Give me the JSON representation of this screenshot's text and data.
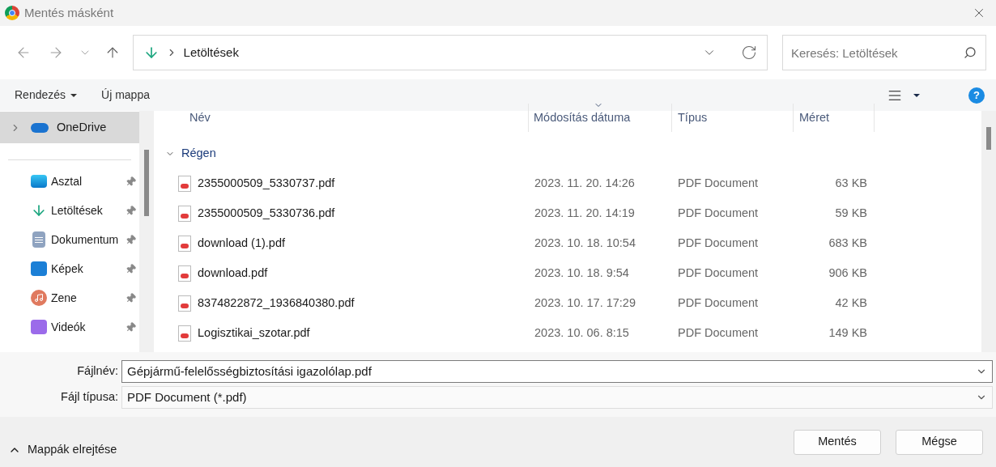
{
  "window": {
    "title": "Mentés másként"
  },
  "nav": {
    "path": "Letöltések",
    "search": {
      "placeholder": "Keresés: Letöltések"
    }
  },
  "toolbar": {
    "organize": "Rendezés",
    "new_folder": "Új mappa",
    "help": "?"
  },
  "sidebar": {
    "top": {
      "label": "OneDrive",
      "selected": true
    },
    "items": [
      {
        "label": "Asztal",
        "kind": "desktop",
        "pinned": true
      },
      {
        "label": "Letöltések",
        "kind": "download",
        "pinned": true
      },
      {
        "label": "Dokumentum",
        "kind": "document",
        "pinned": true
      },
      {
        "label": "Képek",
        "kind": "pictures",
        "pinned": true
      },
      {
        "label": "Zene",
        "kind": "music",
        "pinned": true
      },
      {
        "label": "Videók",
        "kind": "video",
        "pinned": true
      }
    ]
  },
  "table": {
    "columns": [
      "Név",
      "Módosítás dátuma",
      "Típus",
      "Méret"
    ],
    "group": "Régen",
    "rows": [
      {
        "name": "2355000509_5330737.pdf",
        "date": "2023. 11. 20. 14:26",
        "type": "PDF Document",
        "size": "63 KB"
      },
      {
        "name": "2355000509_5330736.pdf",
        "date": "2023. 11. 20. 14:19",
        "type": "PDF Document",
        "size": "59 KB"
      },
      {
        "name": "download (1).pdf",
        "date": "2023. 10. 18. 10:54",
        "type": "PDF Document",
        "size": "683 KB"
      },
      {
        "name": "download.pdf",
        "date": "2023. 10. 18. 9:54",
        "type": "PDF Document",
        "size": "906 KB"
      },
      {
        "name": "8374822872_1936840380.pdf",
        "date": "2023. 10. 17. 17:29",
        "type": "PDF Document",
        "size": "42 KB"
      },
      {
        "name": "Logisztikai_szotar.pdf",
        "date": "2023. 10. 06. 8:15",
        "type": "PDF Document",
        "size": "149 KB"
      }
    ]
  },
  "form": {
    "filename_label": "Fájlnév:",
    "filename": "Gépjármű-felelősségbiztosítási igazolólap.pdf",
    "type_label": "Fájl típusa:",
    "type": "PDF Document (*.pdf)"
  },
  "footer": {
    "hide_folders": "Mappák elrejtése",
    "buttons": [
      "Mentés",
      "Mégse"
    ]
  }
}
